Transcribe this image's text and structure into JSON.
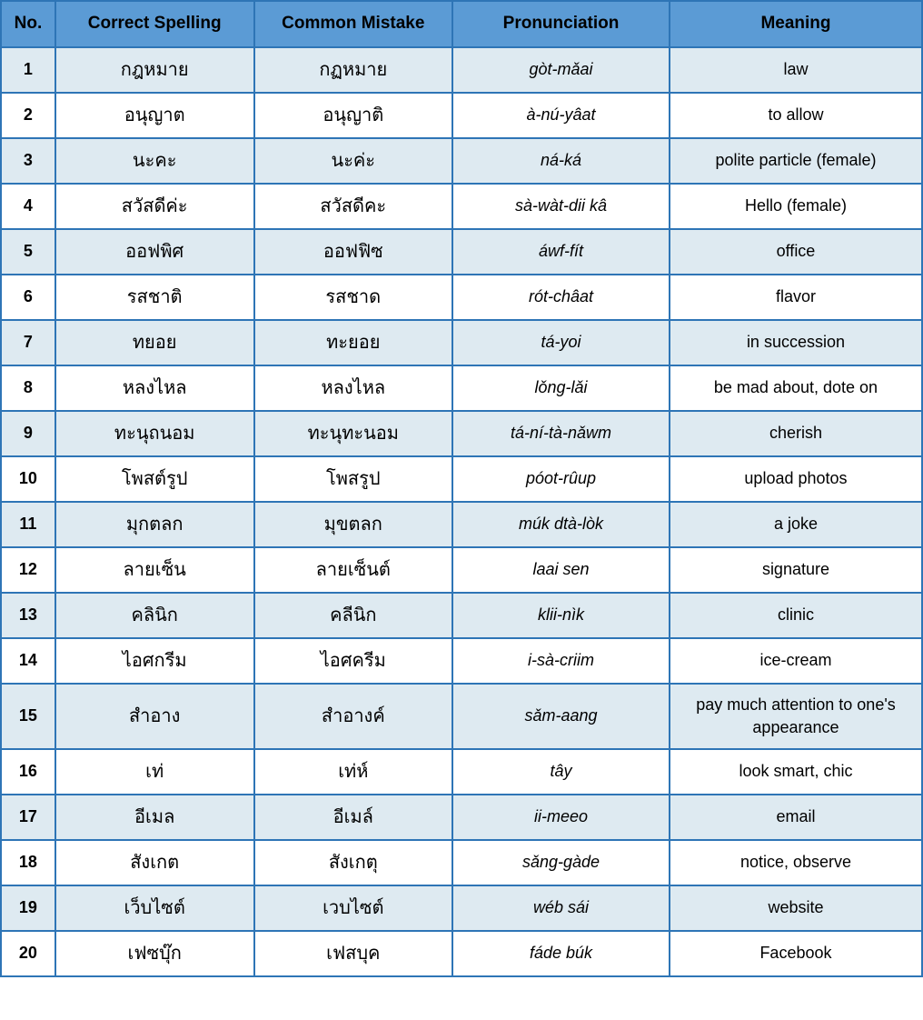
{
  "table": {
    "headers": [
      "No.",
      "Correct Spelling",
      "Common Mistake",
      "Pronunciation",
      "Meaning"
    ],
    "rows": [
      {
        "no": "1",
        "spelling": "กฎหมาย",
        "mistake": "กฏหมาย",
        "pronunciation": "gòt-mǎai",
        "meaning": "law"
      },
      {
        "no": "2",
        "spelling": "อนุญาต",
        "mistake": "อนุญาติ",
        "pronunciation": "à-nú-yâat",
        "meaning": "to allow"
      },
      {
        "no": "3",
        "spelling": "นะคะ",
        "mistake": "นะค่ะ",
        "pronunciation": "ná-ká",
        "meaning": "polite particle (female)"
      },
      {
        "no": "4",
        "spelling": "สวัสดีค่ะ",
        "mistake": "สวัสดีคะ",
        "pronunciation": "sà-wàt-dii kâ",
        "meaning": "Hello (female)"
      },
      {
        "no": "5",
        "spelling": "ออฟพิศ",
        "mistake": "ออฟฟิซ",
        "pronunciation": "áwf-fít",
        "meaning": "office"
      },
      {
        "no": "6",
        "spelling": "รสชาติ",
        "mistake": "รสชาด",
        "pronunciation": "rót-châat",
        "meaning": "flavor"
      },
      {
        "no": "7",
        "spelling": "ทยอย",
        "mistake": "ทะยอย",
        "pronunciation": "tá-yoi",
        "meaning": "in succession"
      },
      {
        "no": "8",
        "spelling": "หลงไหล",
        "mistake": "หลงไหล",
        "pronunciation": "lǒng-lǎi",
        "meaning": "be mad about, dote on"
      },
      {
        "no": "9",
        "spelling": "ทะนุถนอม",
        "mistake": "ทะนุทะนอม",
        "pronunciation": "tá-ní-tà-nǎwm",
        "meaning": "cherish"
      },
      {
        "no": "10",
        "spelling": "โพสต์รูป",
        "mistake": "โพสรูป",
        "pronunciation": "póot-rûup",
        "meaning": "upload photos"
      },
      {
        "no": "11",
        "spelling": "มุกตลก",
        "mistake": "มุขตลก",
        "pronunciation": "múk dtà-lòk",
        "meaning": "a joke"
      },
      {
        "no": "12",
        "spelling": "ลายเซ็น",
        "mistake": "ลายเซ็นต์",
        "pronunciation": "laai sen",
        "meaning": "signature"
      },
      {
        "no": "13",
        "spelling": "คลินิก",
        "mistake": "คลีนิก",
        "pronunciation": "klii-nìk",
        "meaning": "clinic"
      },
      {
        "no": "14",
        "spelling": "ไอศกรีม",
        "mistake": "ไอศครีม",
        "pronunciation": "i-sà-criim",
        "meaning": "ice-cream"
      },
      {
        "no": "15",
        "spelling": "สำอาง",
        "mistake": "สำอางค์",
        "pronunciation": "sǎm-aang",
        "meaning": "pay much attention to one's appearance"
      },
      {
        "no": "16",
        "spelling": "เท่",
        "mistake": "เท่ห์",
        "pronunciation": "tây",
        "meaning": "look smart, chic"
      },
      {
        "no": "17",
        "spelling": "อีเมล",
        "mistake": "อีเมล์",
        "pronunciation": "ii-meeo",
        "meaning": "email"
      },
      {
        "no": "18",
        "spelling": "สังเกต",
        "mistake": "สังเกตุ",
        "pronunciation": "sǎng-gàde",
        "meaning": "notice, observe"
      },
      {
        "no": "19",
        "spelling": "เว็บไซต์",
        "mistake": "เวบไซต์",
        "pronunciation": "wéb sái",
        "meaning": "website"
      },
      {
        "no": "20",
        "spelling": "เฟซบุ๊ก",
        "mistake": "เฟสบุค",
        "pronunciation": "fáde búk",
        "meaning": "Facebook"
      }
    ]
  }
}
